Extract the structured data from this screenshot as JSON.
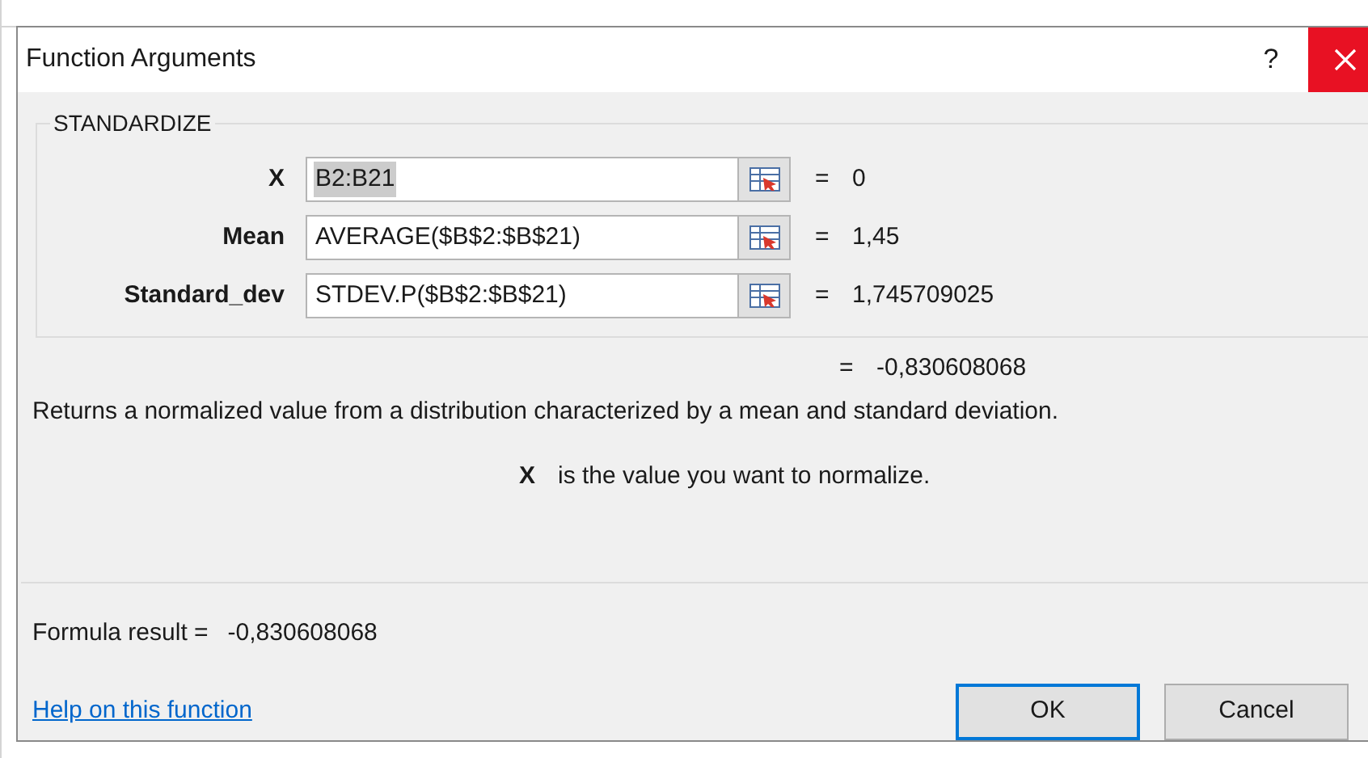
{
  "window": {
    "title": "Function Arguments",
    "help": "?"
  },
  "group": {
    "title": "STANDARDIZE"
  },
  "arguments": [
    {
      "label": "X",
      "value": "B2:B21",
      "highlighted": true,
      "equals": "=",
      "result": "0"
    },
    {
      "label": "Mean",
      "value": "AVERAGE($B$2:$B$21)",
      "highlighted": false,
      "equals": "=",
      "result": "1,45"
    },
    {
      "label": "Standard_dev",
      "value": "STDEV.P($B$2:$B$21)",
      "highlighted": false,
      "equals": "=",
      "result": "1,745709025"
    }
  ],
  "overall_result": {
    "equals": "=",
    "value": "-0,830608068"
  },
  "description": "Returns a normalized value from a distribution characterized by a mean and standard deviation.",
  "argument_help": {
    "name": "X",
    "text": "is the value you want to normalize."
  },
  "formula_result": {
    "label": "Formula result =",
    "value": "-0,830608068"
  },
  "help_link": "Help on this function",
  "buttons": [
    {
      "label": "OK",
      "default": true
    },
    {
      "label": "Cancel",
      "default": false
    }
  ]
}
